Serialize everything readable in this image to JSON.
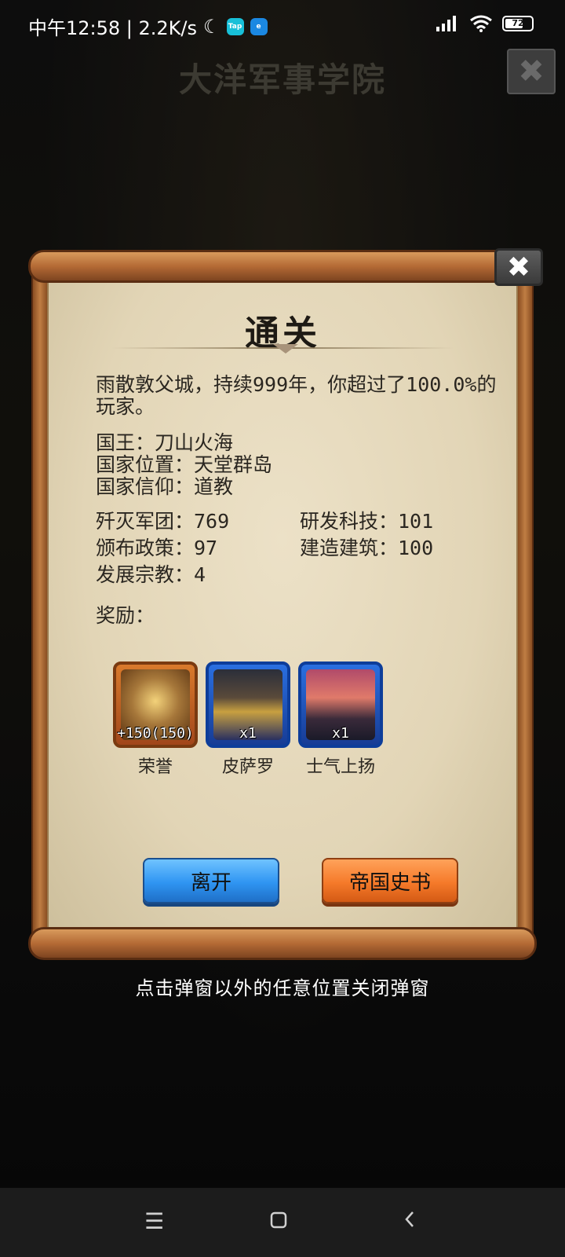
{
  "status_bar": {
    "time_net": "中午12:58 | 2.2K/s",
    "moon_icon": "☾",
    "tap_label": "Tap",
    "sec_label": "e",
    "battery": "72"
  },
  "header": {
    "title": "大洋军事学院"
  },
  "dialog": {
    "title": "通关",
    "summary": "雨散敦父城，持续999年，你超过了100.0%的玩家。",
    "king": "国王：刀山火海",
    "location": "国家位置：天堂群岛",
    "belief": "国家信仰：道教",
    "stats": {
      "armies": "歼灭军团：769",
      "tech": "研发科技：101",
      "policies": "颁布政策：97",
      "buildings": "建造建筑：100",
      "religions": "发展宗教：4"
    },
    "rewards_label": "奖励：",
    "rewards": [
      {
        "name": "荣誉",
        "count": "+150(150)"
      },
      {
        "name": "皮萨罗",
        "count": "x1"
      },
      {
        "name": "士气上扬",
        "count": "x1"
      }
    ],
    "leave_button": "离开",
    "history_button": "帝国史书"
  },
  "hint": "点击弹窗以外的任意位置关闭弹窗",
  "colors": {
    "accent_blue": "#2f95f2",
    "accent_orange": "#f57a2a",
    "paper": "#e2d5b6"
  }
}
